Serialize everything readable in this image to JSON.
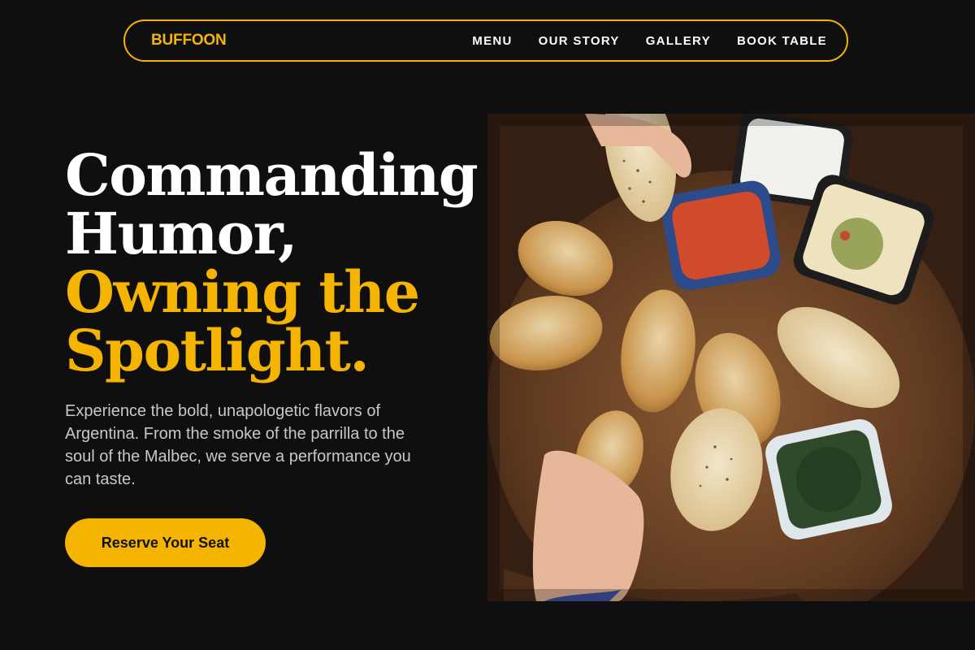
{
  "brand": {
    "name": "BUFFOON",
    "accent_color": "#f5b400"
  },
  "nav": {
    "links": [
      {
        "label": "MENU"
      },
      {
        "label": "OUR STORY"
      },
      {
        "label": "GALLERY"
      },
      {
        "label": "BOOK TABLE"
      }
    ]
  },
  "hero": {
    "headline": {
      "line1": "Commanding",
      "line2": "Humor,",
      "line3": "Owning the",
      "line4": "Spotlight."
    },
    "subhead": "Experience the bold, unapologetic flavors of Argentina. From the smoke of the parrilla to the soul of the Malbec, we serve a performance you can taste.",
    "cta_label": "Reserve Your Seat",
    "image_alt": "Empanadas on a wooden board with dipping sauces"
  }
}
